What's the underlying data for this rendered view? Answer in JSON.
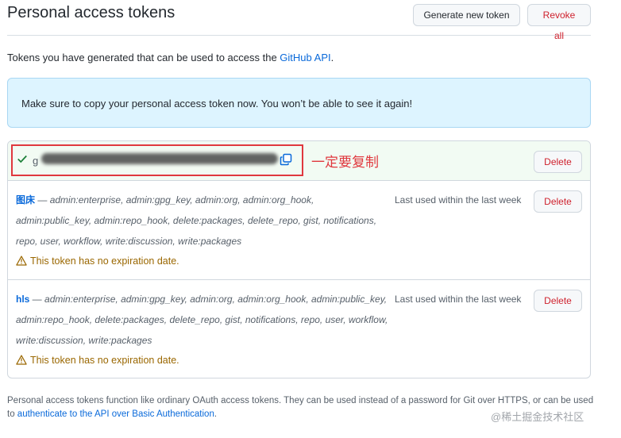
{
  "header": {
    "title": "Personal access tokens",
    "generate_label": "Generate new token",
    "revoke_label": "Revoke all"
  },
  "intro": {
    "text": "Tokens you have generated that can be used to access the ",
    "link": "GitHub API",
    "suffix": "."
  },
  "flash": {
    "message": "Make sure to copy your personal access token now. You won’t be able to see it again!"
  },
  "new_token": {
    "value_prefix": "g",
    "annotation": "一定要复制",
    "delete_label": "Delete"
  },
  "tokens": [
    {
      "name": "图床",
      "separator": " — ",
      "scopes": "admin:enterprise, admin:gpg_key, admin:org, admin:org_hook, admin:public_key, admin:repo_hook, delete:packages, delete_repo, gist, notifications, repo, user, workflow, write:discussion, write:packages",
      "last_used": "Last used within the last week",
      "warning": "This token has no expiration date.",
      "delete_label": "Delete"
    },
    {
      "name": "hls",
      "separator": " — ",
      "scopes": "admin:enterprise, admin:gpg_key, admin:org, admin:org_hook, admin:public_key, admin:repo_hook, delete:packages, delete_repo, gist, notifications, repo, user, workflow, write:discussion, write:packages",
      "last_used": "Last used within the last week",
      "warning": "This token has no expiration date.",
      "delete_label": "Delete"
    }
  ],
  "footer": {
    "text": "Personal access tokens function like ordinary OAuth access tokens. They can be used instead of a password for Git over HTTPS, or can be used to ",
    "link": "authenticate to the API over Basic Authentication",
    "suffix": "."
  },
  "watermark": "@稀土掘金技术社区",
  "colors": {
    "link": "#0969da",
    "danger": "#cf222e",
    "success": "#1a7f37",
    "warning": "#9a6700",
    "annotation": "#e0383e",
    "flash_bg": "#ddf4ff",
    "new_token_bg": "#f2fbf3"
  },
  "icons": {
    "check": "check-icon",
    "copy": "copy-icon",
    "warning": "alert-icon"
  }
}
